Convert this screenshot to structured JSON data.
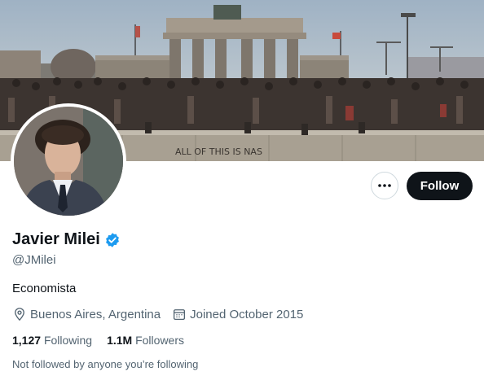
{
  "profile": {
    "name": "Javier Milei",
    "handle": "@JMilei",
    "bio": "Economista",
    "location": "Buenos Aires, Argentina",
    "joined": "Joined October 2015",
    "following_count": "1,127",
    "following_label": "Following",
    "followers_count": "1.1M",
    "followers_label": "Followers",
    "followed_by_text": "Not followed by anyone you’re following"
  },
  "actions": {
    "follow_label": "Follow"
  },
  "banner": {
    "wall_graffiti": "ALL OF THIS IS NAS"
  },
  "icons": {
    "verified": "verified-badge-icon",
    "more": "more-options-icon",
    "location": "location-pin-icon",
    "calendar": "calendar-icon"
  },
  "colors": {
    "verified_blue": "#1d9bf0",
    "follow_button": "#0f1419",
    "secondary_text": "#536471"
  }
}
